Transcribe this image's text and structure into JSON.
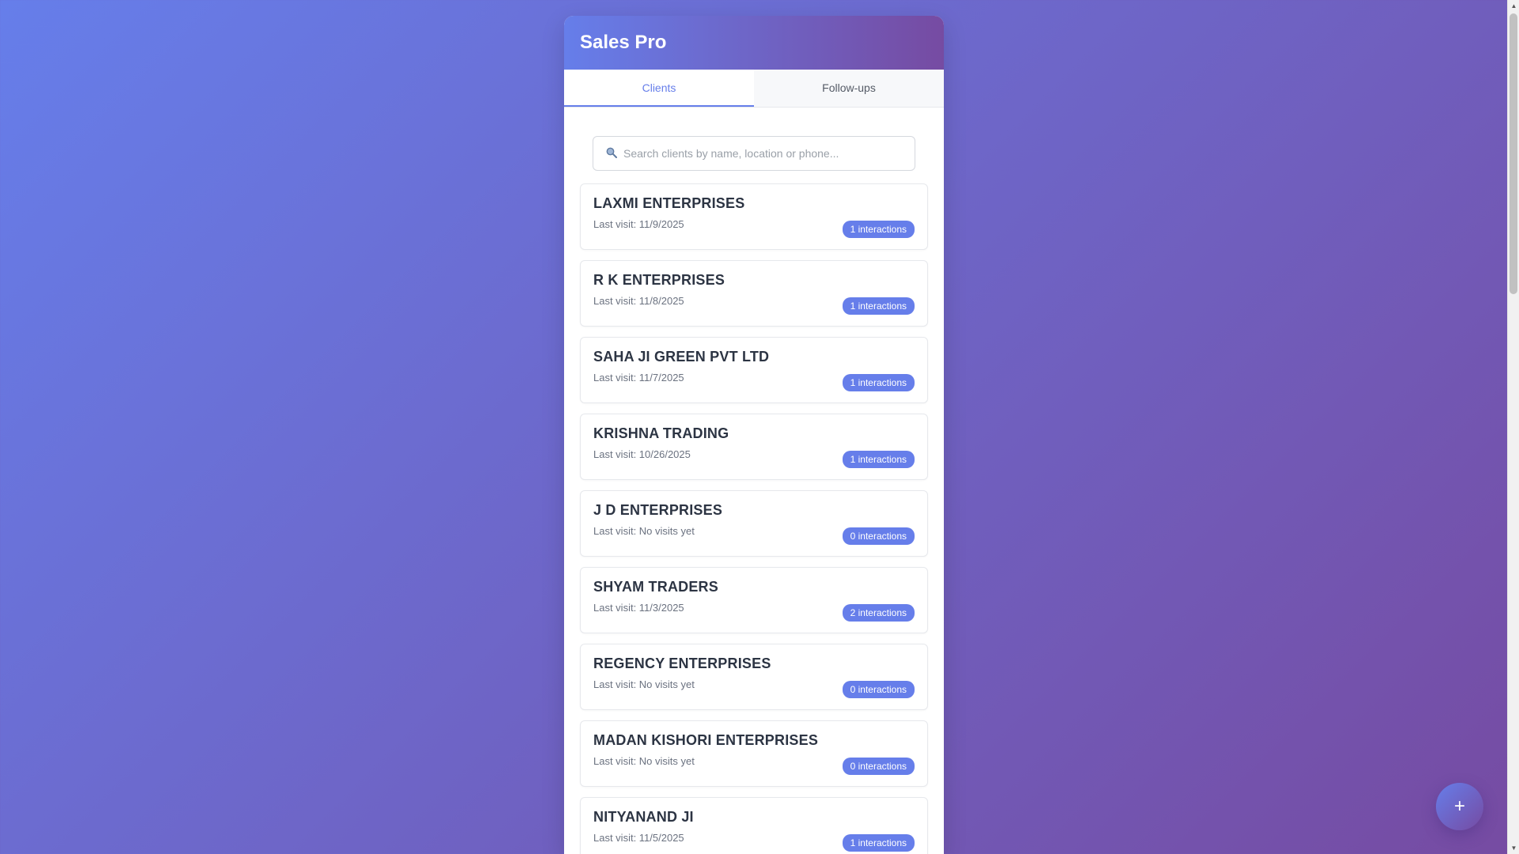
{
  "app": {
    "title": "Sales Pro"
  },
  "tabs": [
    {
      "label": "Clients",
      "active": true
    },
    {
      "label": "Follow-ups",
      "active": false
    }
  ],
  "search": {
    "icon": "search-icon",
    "placeholder": "Search clients by name, location or phone..."
  },
  "clients": [
    {
      "name": "LAXMI ENTERPRISES",
      "last_visit": "Last visit: 11/9/2025",
      "interactions": "1 interactions"
    },
    {
      "name": "R K ENTERPRISES",
      "last_visit": "Last visit: 11/8/2025",
      "interactions": "1 interactions"
    },
    {
      "name": "SAHA JI GREEN PVT LTD",
      "last_visit": "Last visit: 11/7/2025",
      "interactions": "1 interactions"
    },
    {
      "name": "KRISHNA TRADING",
      "last_visit": "Last visit: 10/26/2025",
      "interactions": "1 interactions"
    },
    {
      "name": "J D ENTERPRISES",
      "last_visit": "Last visit: No visits yet",
      "interactions": "0 interactions"
    },
    {
      "name": "SHYAM TRADERS",
      "last_visit": "Last visit: 11/3/2025",
      "interactions": "2 interactions"
    },
    {
      "name": "REGENCY ENTERPRISES",
      "last_visit": "Last visit: No visits yet",
      "interactions": "0 interactions"
    },
    {
      "name": "MADAN KISHORI ENTERPRISES",
      "last_visit": "Last visit: No visits yet",
      "interactions": "0 interactions"
    },
    {
      "name": "NITYANAND JI",
      "last_visit": "Last visit: 11/5/2025",
      "interactions": "1 interactions"
    }
  ],
  "fab": {
    "label": "+",
    "icon": "plus-icon"
  },
  "colors": {
    "accent": "#667eea",
    "accent_secondary": "#764ba2",
    "badge_bg": "#667eea"
  }
}
